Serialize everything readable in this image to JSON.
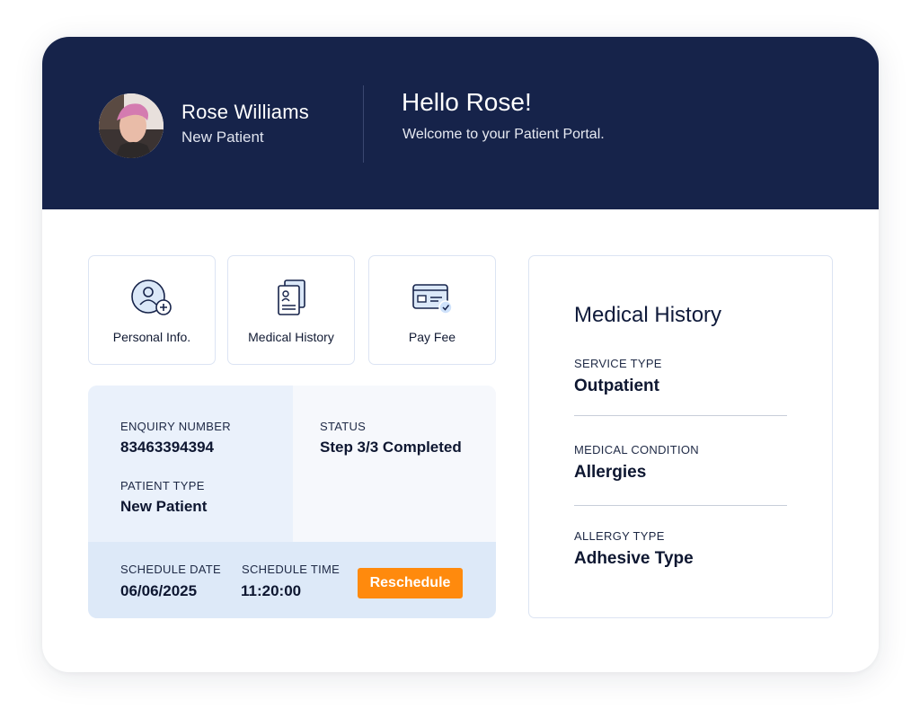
{
  "user": {
    "name": "Rose Williams",
    "role": "New Patient"
  },
  "greeting": {
    "title": "Hello Rose!",
    "subtitle": "Welcome to your Patient Portal."
  },
  "tiles": [
    {
      "label": "Personal Info.",
      "icon": "user-plus-icon"
    },
    {
      "label": "Medical History",
      "icon": "documents-icon"
    },
    {
      "label": "Pay Fee",
      "icon": "card-check-icon"
    }
  ],
  "enquiry": {
    "number_label": "ENQUIRY NUMBER",
    "number_value": "83463394394",
    "status_label": "STATUS",
    "status_value": "Step 3/3 Completed",
    "patient_type_label": "PATIENT TYPE",
    "patient_type_value": "New Patient",
    "schedule_date_label": "SCHEDULE DATE",
    "schedule_date_value": "06/06/2025",
    "schedule_time_label": "SCHEDULE TIME",
    "schedule_time_value": "11:20:00",
    "reschedule_label": "Reschedule"
  },
  "medical_history": {
    "title": "Medical History",
    "items": [
      {
        "label": "SERVICE TYPE",
        "value": "Outpatient"
      },
      {
        "label": "MEDICAL CONDITION",
        "value": "Allergies"
      },
      {
        "label": "ALLERGY TYPE",
        "value": "Adhesive Type"
      }
    ]
  },
  "colors": {
    "header_bg": "#16234a",
    "accent_blue": "#1e5fb4",
    "button_orange": "#ff8a0d",
    "panel_light": "#eaf1fb",
    "schedule_bg": "#dde9f8"
  }
}
